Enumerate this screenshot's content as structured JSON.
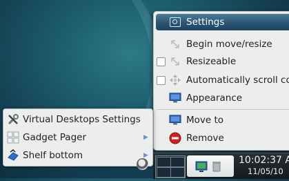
{
  "context_menu": {
    "title": "Settings",
    "items": [
      {
        "label": "Begin move/resize",
        "icon": "move-resize-icon",
        "checkbox": false
      },
      {
        "label": "Resizeable",
        "icon": "resize-icon",
        "checkbox": true,
        "checked": false
      },
      {
        "label": "Automatically scroll co",
        "icon": "scroll-arrows-icon",
        "checkbox": true,
        "checked": false
      },
      {
        "label": "Appearance",
        "icon": "monitor-icon",
        "checkbox": false
      },
      {
        "label": "Move to",
        "icon": "monitor-icon",
        "checkbox": false
      },
      {
        "label": "Remove",
        "icon": "remove-icon",
        "checkbox": false
      }
    ]
  },
  "left_menu": {
    "items": [
      {
        "label": "Virtual Desktops Settings",
        "icon": "tools-icon",
        "submenu": false
      },
      {
        "label": "Gadget Pager",
        "icon": "pager-icon",
        "submenu": true
      },
      {
        "label": "Shelf bottom",
        "icon": "shelf-icon",
        "submenu": true
      }
    ]
  },
  "panel": {
    "clock_time": "10:02:37 A",
    "clock_date": "11/05/10"
  },
  "colors": {
    "menu_bg": "#eceeed",
    "title_bar": "#2a5574",
    "panel_bg": "#1a1e21",
    "remove_red": "#cc2222"
  }
}
